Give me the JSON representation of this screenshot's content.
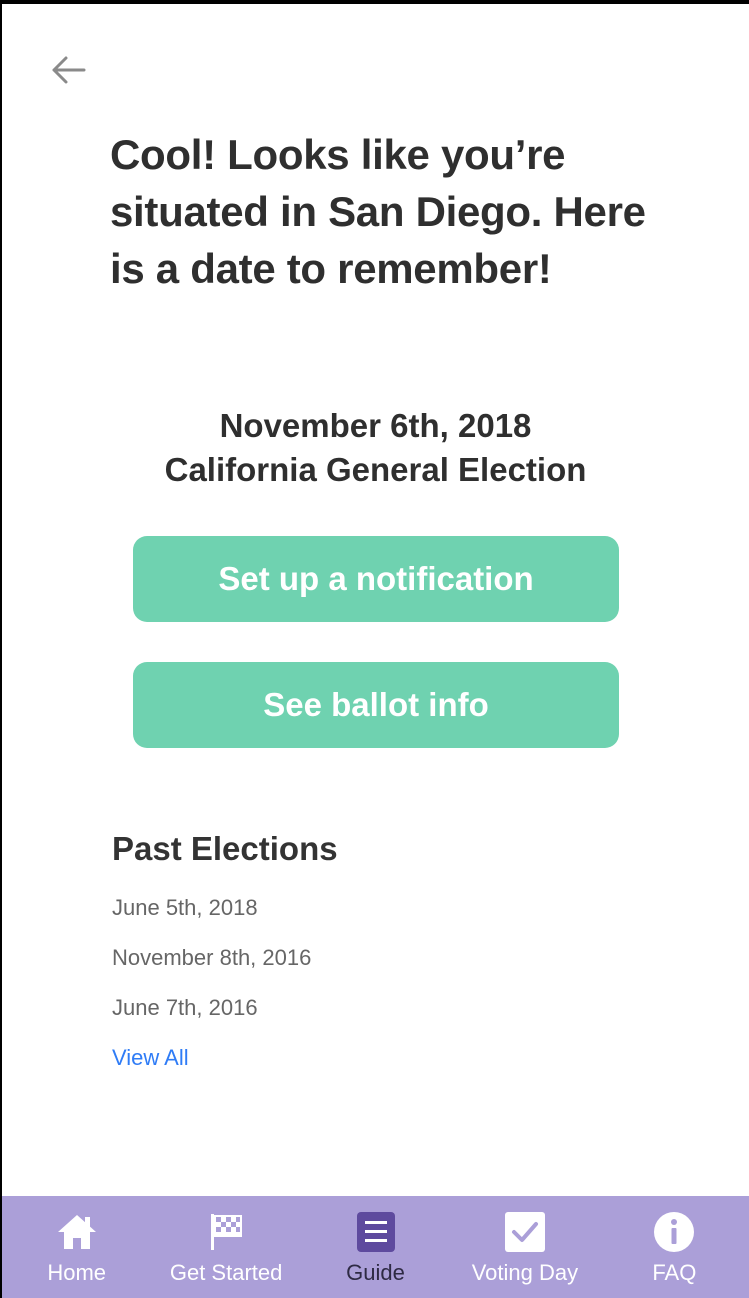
{
  "header": {
    "back_icon": "arrow-left-icon"
  },
  "main": {
    "headline": "Cool! Looks like you’re situated in San Diego. Here is a date to remember!",
    "event_date": "November 6th, 2018",
    "event_name": "California General Election",
    "notify_button": "Set up a notification",
    "ballot_button": "See ballot info"
  },
  "past_elections": {
    "title": "Past Elections",
    "items": [
      "June 5th, 2018",
      "November 8th, 2016",
      "June 7th, 2016"
    ],
    "view_all": "View All"
  },
  "tabbar": {
    "active": "Guide",
    "colors": {
      "background": "#ab9fd8",
      "active_icon": "#5e4a9e",
      "accent": "#6fd2b0",
      "link": "#2f7cf6"
    },
    "items": [
      {
        "label": "Home",
        "icon": "home-icon"
      },
      {
        "label": "Get Started",
        "icon": "checkered-flag-icon"
      },
      {
        "label": "Guide",
        "icon": "document-icon"
      },
      {
        "label": "Voting Day",
        "icon": "checkbox-icon"
      },
      {
        "label": "FAQ",
        "icon": "info-icon"
      }
    ]
  }
}
